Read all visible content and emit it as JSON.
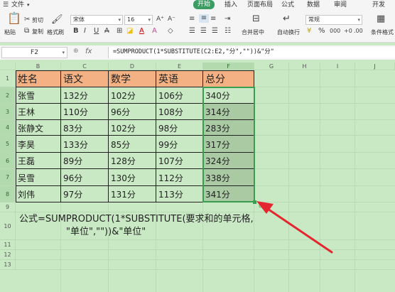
{
  "ribbon": {
    "file_menu": "文件",
    "tabs": [
      "开始",
      "插入",
      "页面布局",
      "公式",
      "数据",
      "审阅",
      "开发"
    ],
    "active_tab": "开始",
    "cut": "剪切",
    "copy": "复制",
    "paste": "粘贴",
    "format_painter": "格式刷",
    "font_name": "宋体",
    "font_size": "16",
    "merge": "合并居中",
    "wrap": "自动换行",
    "number_format": "常规",
    "conditional": "条件格式"
  },
  "formula_bar": {
    "cell_ref": "F2",
    "fx": "fx",
    "formula": "=SUMPRODUCT(1*SUBSTITUTE(C2:E2,\"分\",\"\"))&\"分\""
  },
  "columns": [
    "B",
    "C",
    "D",
    "E",
    "F",
    "G",
    "H",
    "I",
    "J"
  ],
  "rows": [
    "1",
    "2",
    "3",
    "4",
    "5",
    "6",
    "7",
    "8",
    "9",
    "10",
    "11",
    "12",
    "13"
  ],
  "table": {
    "headers": [
      "姓名",
      "语文",
      "数学",
      "英语",
      "总分"
    ],
    "rows": [
      [
        "张雪",
        "132分",
        "102分",
        "106分",
        "340分"
      ],
      [
        "王林",
        "110分",
        "96分",
        "108分",
        "314分"
      ],
      [
        "张静文",
        "83分",
        "102分",
        "98分",
        "283分"
      ],
      [
        "李昊",
        "133分",
        "85分",
        "99分",
        "317分"
      ],
      [
        "王磊",
        "89分",
        "128分",
        "107分",
        "324分"
      ],
      [
        "吴雪",
        "96分",
        "130分",
        "112分",
        "338分"
      ],
      [
        "刘伟",
        "97分",
        "131分",
        "113分",
        "341分"
      ]
    ]
  },
  "note": {
    "line1": "公式=SUMPRODUCT(1*SUBSTITUTE(要求和的单元格,",
    "line2": "\"单位\",\"\"))&\"单位\""
  },
  "colors": {
    "sheet_bg": "#c9e9c4",
    "header_fill": "#f4b183",
    "selected_fill": "#aacaa3",
    "active_tab": "#3a9e63",
    "arrow": "#e3262f"
  }
}
